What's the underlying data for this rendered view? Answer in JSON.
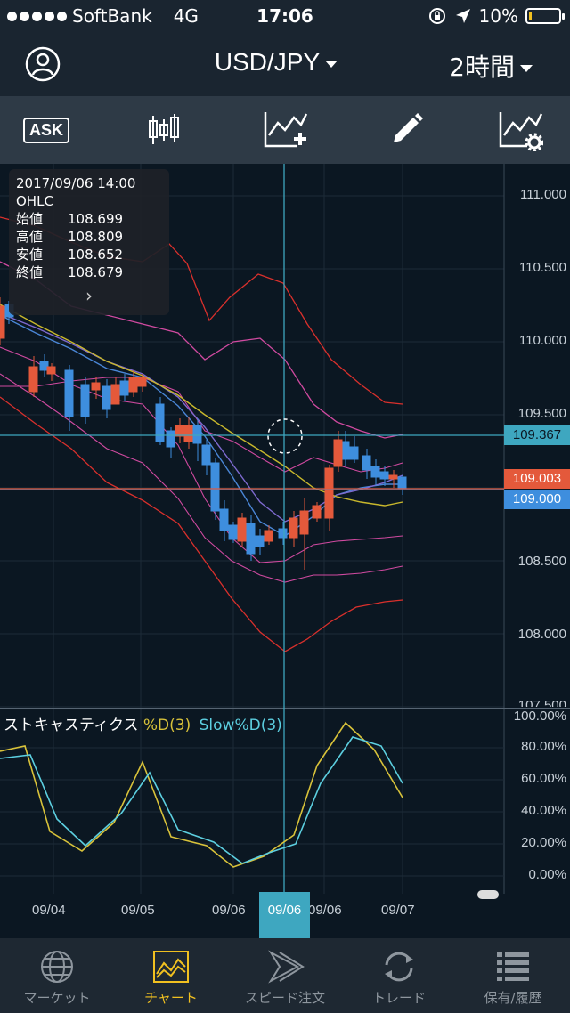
{
  "status_bar": {
    "carrier": "SoftBank",
    "network": "4G",
    "time": "17:06",
    "battery": "10%",
    "battery_fraction": 0.1
  },
  "nav": {
    "pair": "USD/JPY",
    "period": "2時間"
  },
  "toolbar": {
    "ask_label": "ASK"
  },
  "ohlc": {
    "date": "2017/09/06 14:00",
    "title": "OHLC",
    "rows": [
      {
        "k": "始値",
        "v": "108.699"
      },
      {
        "k": "高値",
        "v": "108.809"
      },
      {
        "k": "安値",
        "v": "108.652"
      },
      {
        "k": "終値",
        "v": "108.679"
      }
    ]
  },
  "price_axis": [
    "111.000",
    "110.500",
    "110.000",
    "109.500",
    "108.500",
    "108.000",
    "107.500"
  ],
  "price_tags": {
    "cursor": "109.367",
    "current_ask": "109.003",
    "current_bid": "109.000"
  },
  "stochastic": {
    "title_main": "ストキャスティクス",
    "title_d": "%D(3)",
    "title_slow": "Slow%D(3)",
    "axis": [
      "100.00%",
      "80.00%",
      "60.00%",
      "40.00%",
      "20.00%",
      "0.00%"
    ]
  },
  "x_axis": {
    "labels": [
      "09/04",
      "09/05",
      "09/06",
      "09/06",
      "09/07"
    ],
    "cursor_label": "09/06"
  },
  "colors": {
    "up": "#e4593b",
    "down": "#3e8ede",
    "cursor": "#3ea7c0",
    "active": "#f0c020"
  },
  "tabs": [
    {
      "label": "マーケット",
      "icon": "globe-icon"
    },
    {
      "label": "チャート",
      "icon": "chart-icon",
      "active": true
    },
    {
      "label": "スピード注文",
      "icon": "speed-icon"
    },
    {
      "label": "トレード",
      "icon": "refresh-icon"
    },
    {
      "label": "保有/履歴",
      "icon": "list-icon"
    }
  ]
}
